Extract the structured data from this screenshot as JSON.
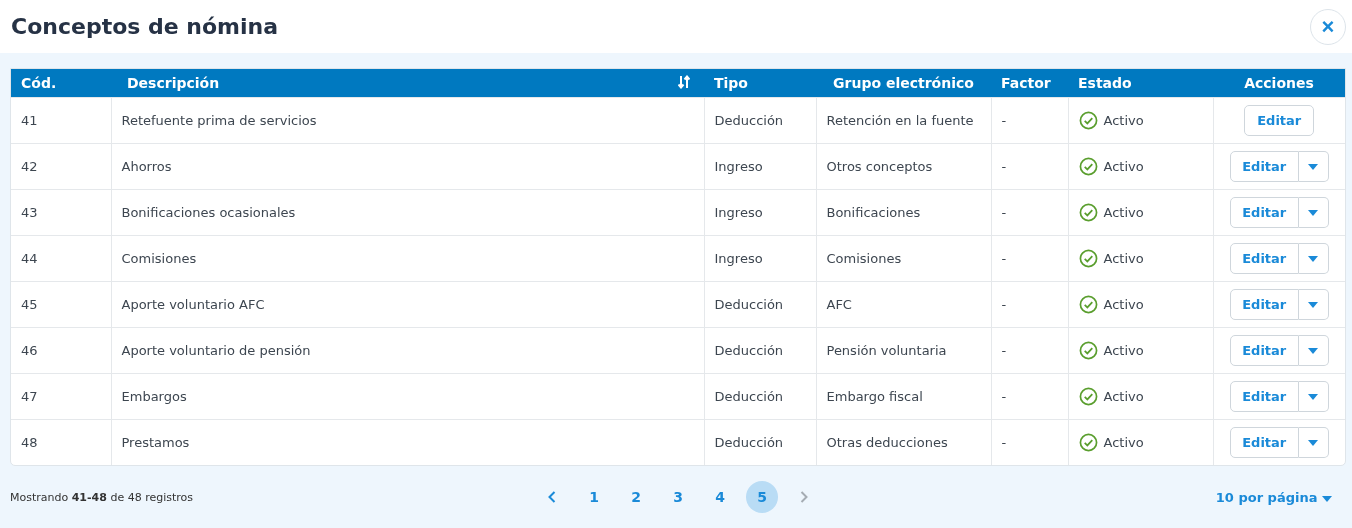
{
  "title": "Conceptos de nómina",
  "close_label": "×",
  "table": {
    "columns": [
      {
        "label": "Cód.",
        "sortable": false
      },
      {
        "label": "Descripción",
        "sortable": true
      },
      {
        "label": "Tipo",
        "sortable": false
      },
      {
        "label": "Grupo electrónico",
        "sortable": false
      },
      {
        "label": "Factor",
        "sortable": false
      },
      {
        "label": "Estado",
        "sortable": false
      },
      {
        "label": "Acciones",
        "sortable": false
      }
    ],
    "rows": [
      {
        "code": "41",
        "description": "Retefuente prima de servicios",
        "type": "Deducción",
        "group": "Retención en la fuente",
        "factor": "-",
        "status": "Activo",
        "active": true,
        "action": "Editar",
        "kind": "single"
      },
      {
        "code": "42",
        "description": "Ahorros",
        "type": "Ingreso",
        "group": "Otros conceptos",
        "factor": "-",
        "status": "Activo",
        "active": true,
        "action": "Editar",
        "kind": "split"
      },
      {
        "code": "43",
        "description": "Bonificaciones ocasionales",
        "type": "Ingreso",
        "group": "Bonificaciones",
        "factor": "-",
        "status": "Activo",
        "active": true,
        "action": "Editar",
        "kind": "split"
      },
      {
        "code": "44",
        "description": "Comisiones",
        "type": "Ingreso",
        "group": "Comisiones",
        "factor": "-",
        "status": "Activo",
        "active": true,
        "action": "Editar",
        "kind": "split"
      },
      {
        "code": "45",
        "description": "Aporte voluntario AFC",
        "type": "Deducción",
        "group": "AFC",
        "factor": "-",
        "status": "Activo",
        "active": true,
        "action": "Editar",
        "kind": "split"
      },
      {
        "code": "46",
        "description": "Aporte voluntario de pensión",
        "type": "Deducción",
        "group": "Pensión voluntaria",
        "factor": "-",
        "status": "Activo",
        "active": true,
        "action": "Editar",
        "kind": "split"
      },
      {
        "code": "47",
        "description": "Embargos",
        "type": "Deducción",
        "group": "Embargo fiscal",
        "factor": "-",
        "status": "Activo",
        "active": true,
        "action": "Editar",
        "kind": "split"
      },
      {
        "code": "48",
        "description": "Prestamos",
        "type": "Deducción",
        "group": "Otras deducciones",
        "factor": "-",
        "status": "Activo",
        "active": true,
        "action": "Editar",
        "kind": "split"
      }
    ]
  },
  "footer": {
    "summary": "Mostrando **41-48** de 48 registros",
    "pagination": {
      "prev_disabled": false,
      "next_disabled": true,
      "pages": [
        {
          "label": "1",
          "selected": false
        },
        {
          "label": "2",
          "selected": false
        },
        {
          "label": "3",
          "selected": false
        },
        {
          "label": "4",
          "selected": false
        },
        {
          "label": "5",
          "selected": true
        }
      ]
    },
    "page_size": "10 por página"
  }
}
